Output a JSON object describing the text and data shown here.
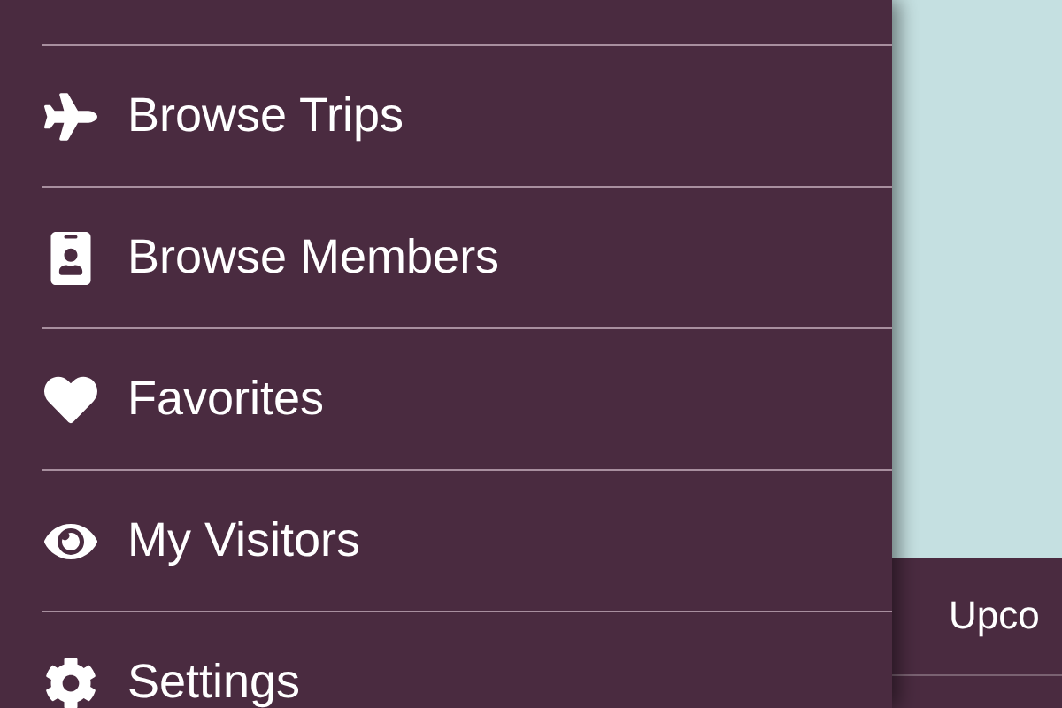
{
  "menu": {
    "items": [
      {
        "label": "Browse Trips"
      },
      {
        "label": "Browse Members"
      },
      {
        "label": "Favorites"
      },
      {
        "label": "My Visitors"
      },
      {
        "label": "Settings"
      }
    ]
  },
  "side_panel": {
    "section_title": "Upco"
  }
}
